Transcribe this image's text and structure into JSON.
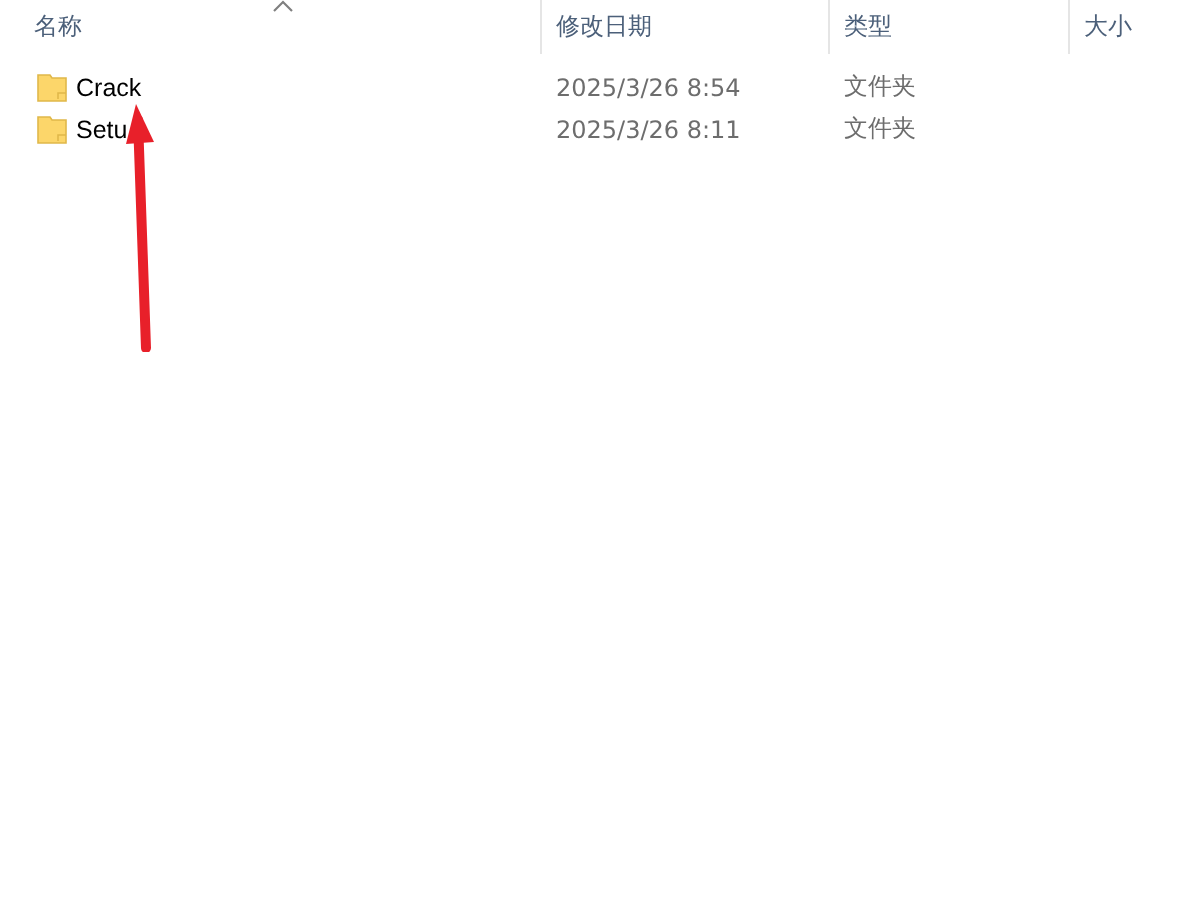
{
  "columns": [
    {
      "label": "名称",
      "sorted": true
    },
    {
      "label": "修改日期",
      "sorted": false
    },
    {
      "label": "类型",
      "sorted": false
    },
    {
      "label": "大小",
      "sorted": false
    }
  ],
  "rows": [
    {
      "name": "Crack",
      "modified": "2025/3/26 8:54",
      "type": "文件夹"
    },
    {
      "name": "Setu",
      "modified": "2025/3/26 8:11",
      "type": "文件夹"
    }
  ],
  "annotation": {
    "kind": "arrow",
    "color": "#e8202a"
  }
}
